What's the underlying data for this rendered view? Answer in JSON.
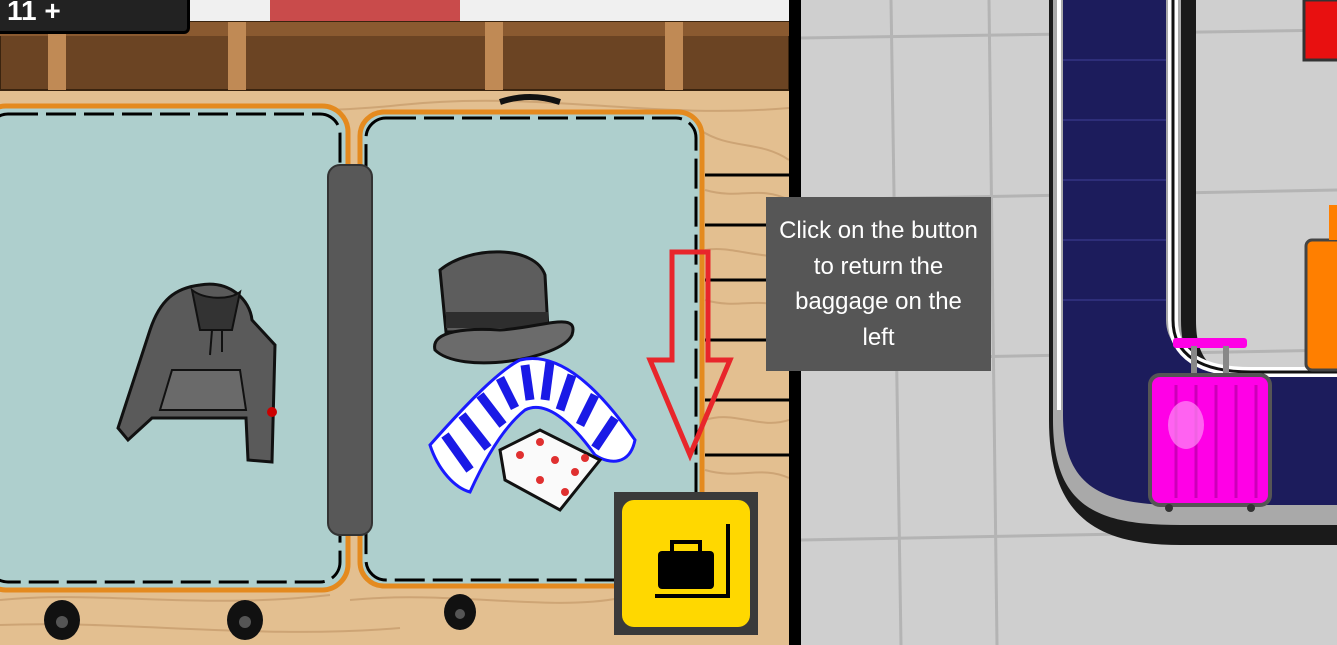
{
  "hud": {
    "value": "11 +"
  },
  "tooltip": {
    "text": "Click on the button to return the baggage on the left"
  },
  "return_button": {
    "icon": "baggage-claim-icon",
    "color": "#ffd800"
  },
  "hint_arrow": {
    "color": "#e8262b"
  },
  "suitcase_items": [
    "hoodie-icon",
    "top-hat-icon",
    "socks-icon",
    "boxer-shorts-icon"
  ],
  "carousel": {
    "suitcases": [
      "pink-suitcase",
      "orange-suitcase",
      "red-suitcase"
    ]
  }
}
